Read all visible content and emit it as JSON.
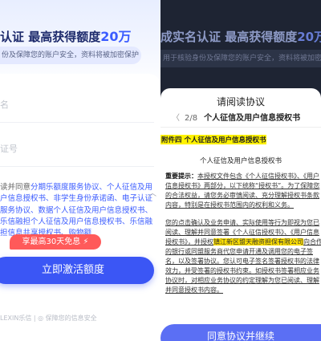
{
  "left": {
    "headline_main": "认证 最高获得额度",
    "headline_amount": "20万",
    "subline": "份及保障您的账户安全，资料将被加密保护",
    "fields": [
      {
        "label": "名"
      },
      {
        "label": "证号"
      }
    ],
    "agreement_prefix": "读并同意",
    "agreement_text": "分期乐额度服务协议、个人征信及用户信息授权书、非学生身份承诺函、电子认证服务协议、数据个人征信及用户信息授权书、乐信融担个人征信及用户信息授权书、乐信融担信息共享授权书、购物额",
    "promo": "享最高30天免息 ⚡",
    "cta_label": "立即激活额度",
    "footer": "LEXIN乐信 | ◎ 保障您的信息安全"
  },
  "right": {
    "bg_headline_main": "成实名认证 最高获得额度",
    "bg_headline_amount": "20万",
    "bg_subline": "用于核验身份及保障您的账户安全，资料将被加密保护",
    "sheet_title": "请阅读协议",
    "nav_page": "2/8",
    "nav_doc": "个人征信及用户信息授权书",
    "section": "附件四 个人征信及用户信息授权书",
    "doc_heading": "个人征信及用户信息授权书",
    "para1_prefix": "重要提示：",
    "para1": "本授权文件包含《个人征信授权书》、《用户信息授权书》两部分，以下统称“授权书”。为了保障您的合法权益，请您务必审慎阅读、充分理解授权书条款内容，特别是在授权书范围内的权利和义务。",
    "para2_a": "您的点击确认及业务申请、实际使用等行为即视为您已阅读、理解并同意签署《个人征信授权书》、《用户信息授权书》，并授权",
    "para2_company": "镇江新区盟天融资担保有限公司",
    "para2_b": "向合作的银行或同盟服务商代您申请开通及调用您的电子签名，以及签署协议。您认可电子签名签署授权书的法律效力，并受签署的授权书约束。如授权书签署相应业务协议时，对相应业务协议的约定理解为您已阅读、理解并同意授权书内容。",
    "accept_label": "同意协议并继续"
  }
}
